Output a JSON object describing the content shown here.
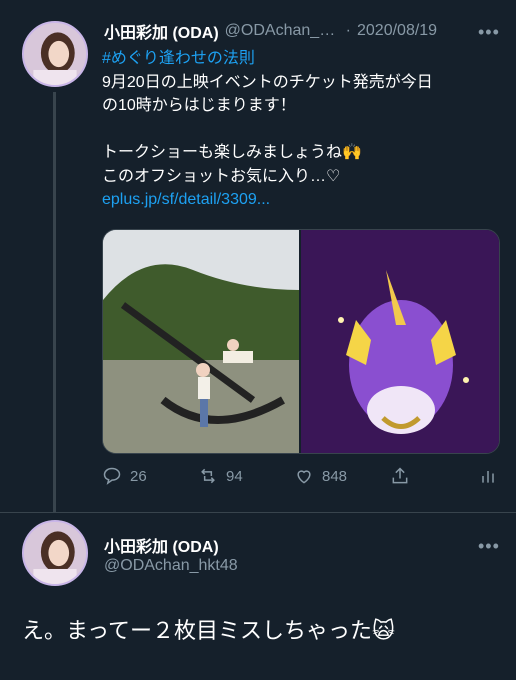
{
  "tweet1": {
    "author_name": "小田彩加 (ODA)",
    "handle": "@ODAchan_hkt48",
    "separator": "·",
    "date": "2020/08/19",
    "more_label": "•••",
    "lines": [
      "#めぐり逢わせの法則",
      "9月20日の上映イベントのチケット発売が今日",
      "の10時からはじまります！",
      "",
      "トークショーも楽しみましょうね🙌",
      "このオフショットお気に入り…♡",
      "eplus.jp/sf/detail/3309..."
    ],
    "stats": {
      "replies": "26",
      "retweets": "94",
      "likes": "848"
    }
  },
  "tweet2": {
    "author_name": "小田彩加 (ODA)",
    "handle": "@ODAchan_hkt48",
    "more_label": "•••",
    "text": "え。まってー２枚目ミスしちゃった🙀"
  },
  "colors": {
    "background": "#15202b",
    "link": "#1da1f2",
    "muted": "#8899a6",
    "border": "#38444d"
  },
  "icons": [
    "reply-icon",
    "retweet-icon",
    "like-icon",
    "share-icon",
    "analytics-icon"
  ]
}
